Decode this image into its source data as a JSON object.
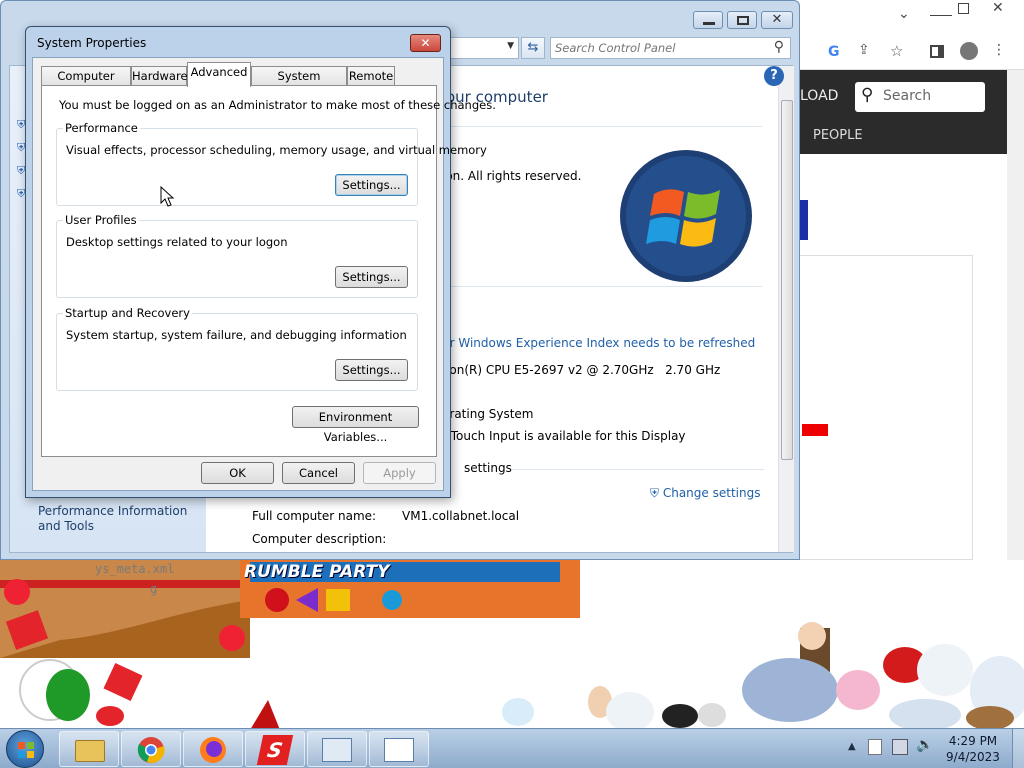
{
  "control_panel": {
    "search_placeholder": "Search Control Panel",
    "heading_fragment": "our computer",
    "copyright_fragment": "ion.  All rights reserved.",
    "wei_link": "ur Windows Experience Index needs to be refreshed",
    "processor_value": "eon(R) CPU E5-2697 v2 @ 2.70GHz   2.70 GHz",
    "system_type_fragment": "erating System",
    "pen_touch_fragment": "r Touch Input is available for this Display",
    "settings_fragment": "settings",
    "change_settings_label": "Change settings",
    "computer_name_label": "Full computer name:",
    "computer_name_value": "VM1.collabnet.local",
    "computer_description_label": "Computer description:",
    "left_link": "Performance Information and Tools",
    "help_label": "?"
  },
  "browser": {
    "nav_fragment": "LOAD",
    "search_label": "Search",
    "nav_item": "PEOPLE"
  },
  "background": {
    "file_fragment": "ys_meta.xml",
    "file_fragment2": "g",
    "game_title": "RUMBLE PARTY"
  },
  "dialog": {
    "title": "System Properties",
    "tabs": [
      {
        "label": "Computer Name"
      },
      {
        "label": "Hardware"
      },
      {
        "label": "Advanced"
      },
      {
        "label": "System Protection"
      },
      {
        "label": "Remote"
      }
    ],
    "admin_note": "You must be logged on as an Administrator to make most of these changes.",
    "groups": [
      {
        "title": "Performance",
        "description": "Visual effects, processor scheduling, memory usage, and virtual memory",
        "button": "Settings..."
      },
      {
        "title": "User Profiles",
        "description": "Desktop settings related to your logon",
        "button": "Settings..."
      },
      {
        "title": "Startup and Recovery",
        "description": "System startup, system failure, and debugging information",
        "button": "Settings..."
      }
    ],
    "env_button": "Environment Variables...",
    "ok": "OK",
    "cancel": "Cancel",
    "apply": "Apply"
  },
  "taskbar": {
    "time": "4:29 PM",
    "date": "9/4/2023"
  },
  "colors": {
    "link_blue": "#1f5fa8",
    "taskbar": "#9cb7d6",
    "close_red": "#c9483b"
  }
}
